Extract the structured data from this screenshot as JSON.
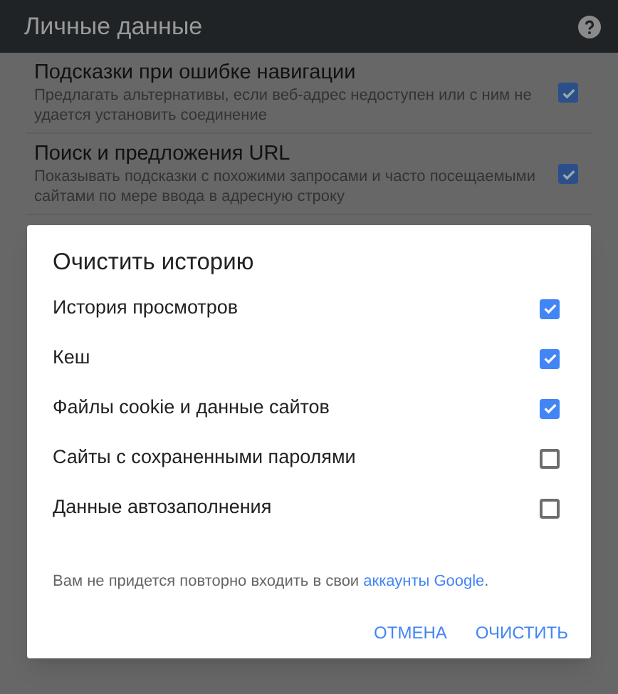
{
  "app_bar": {
    "title": "Личные данные"
  },
  "settings": [
    {
      "title": "Подсказки при ошибке навигации",
      "description": "Предлагать альтернативы, если веб-адрес недоступен или с ним не удается установить соединение",
      "checked": true
    },
    {
      "title": "Поиск и предложения URL",
      "description": "Показывать подсказки с похожими запросами и часто посещаемыми сайтами по мере ввода в адресную строку",
      "checked": true
    }
  ],
  "dialog": {
    "title": "Очистить историю",
    "options": [
      {
        "label": "История просмотров",
        "checked": true
      },
      {
        "label": "Кеш",
        "checked": true
      },
      {
        "label": "Файлы cookie и данные сайтов",
        "checked": true
      },
      {
        "label": "Сайты с сохраненными паролями",
        "checked": false
      },
      {
        "label": "Данные автозаполнения",
        "checked": false
      }
    ],
    "note": {
      "text": "Вам не придется повторно входить в свои ",
      "link": "аккаунты Google",
      "after": "."
    },
    "buttons": [
      "ОТМЕНА",
      "ОЧИСТИТЬ"
    ]
  }
}
